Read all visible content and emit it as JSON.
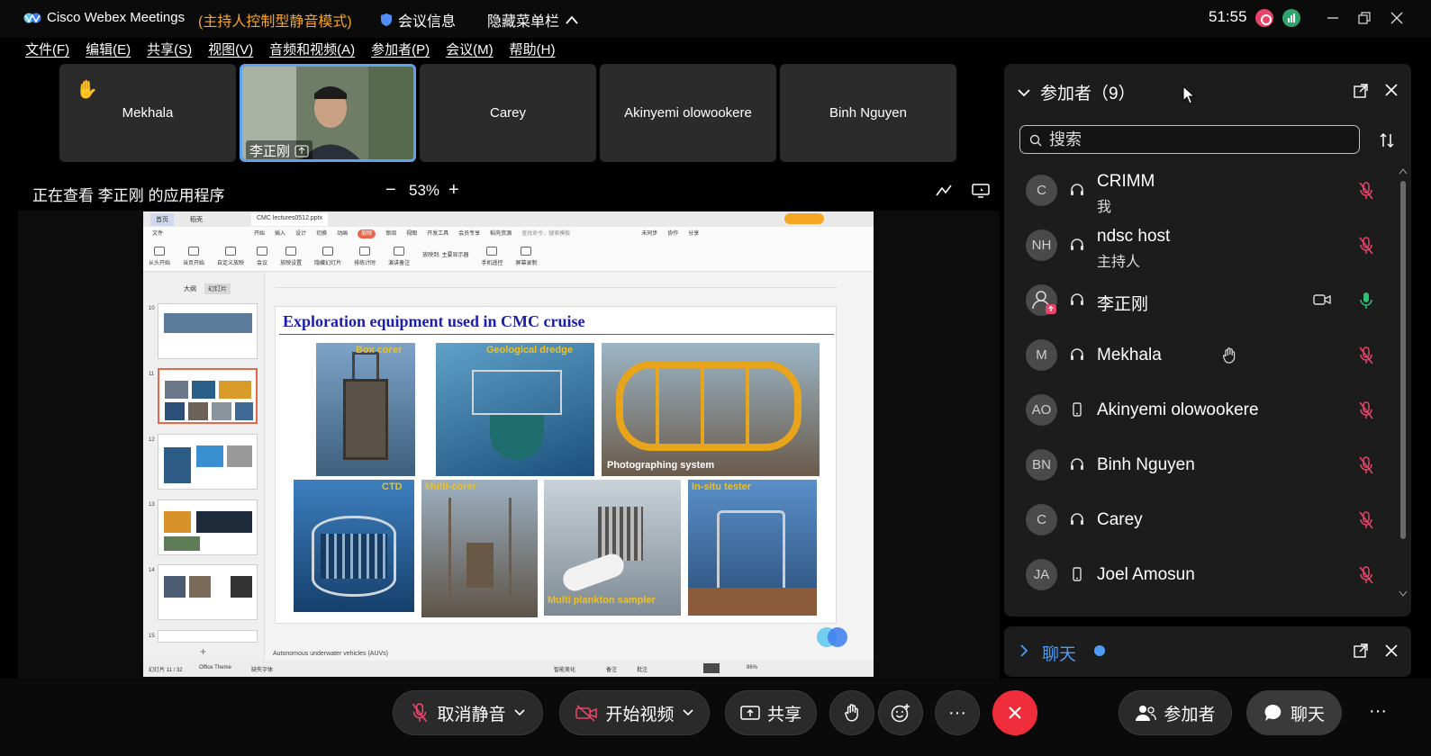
{
  "titlebar": {
    "app_name": "Cisco Webex Meetings",
    "mode": "(主持人控制型静音模式)",
    "meeting_info": "会议信息",
    "hide_menu": "隐藏菜单栏",
    "clock": "51:55"
  },
  "menu": [
    "文件(F)",
    "编辑(E)",
    "共享(S)",
    "视图(V)",
    "音频和视频(A)",
    "参加者(P)",
    "会议(M)",
    "帮助(H)"
  ],
  "tiles": [
    {
      "name": "Mekhala",
      "hand": "✋"
    },
    {
      "name": "李正刚",
      "active": true
    },
    {
      "name": "Carey"
    },
    {
      "name": "Akinyemi olowookere"
    },
    {
      "name": "Binh Nguyen"
    }
  ],
  "viewing": {
    "label": "正在查看 李正刚 的应用程序",
    "zoom": "53%"
  },
  "ppt": {
    "tabs": [
      "首页",
      "稻壳",
      "CMC lectures0512.pptx"
    ],
    "ribbon_menu": [
      "文件",
      "开始",
      "插入",
      "设计",
      "切换",
      "动画",
      "放映",
      "审阅",
      "视图",
      "开发工具",
      "会员专享",
      "稻壳资源",
      "查找命令、搜索模板",
      "未同步",
      "协作",
      "分享"
    ],
    "ribbon_tools": [
      "从头开始",
      "当页开始",
      "自定义放映",
      "会议",
      "放映设置",
      "隐藏幻灯片",
      "排练计时",
      "演讲备注",
      "放映到: 主要显示器",
      "手机遥控",
      "屏幕录制"
    ],
    "panel_tabs": [
      "大纲",
      "幻灯片"
    ],
    "thumb_numbers": [
      "10",
      "11",
      "12",
      "13",
      "14",
      "15"
    ],
    "slide_title": "Exploration equipment used in CMC cruise",
    "captions": {
      "box": "Box corer",
      "dredge": "Geological dredge",
      "photo": "Photographing system",
      "ctd": "CTD",
      "multi": "Multi-corer",
      "plankton": "Multi plankton sampler",
      "insitu": "In-situ tester"
    },
    "notes": "Autonomous underwater vehicles (AUVs)",
    "status_left": "幻灯片 11 / 32",
    "status_theme": "Office Theme",
    "status_font": "缺失字体",
    "status_beauty": "智能美化",
    "status_notes": "备注",
    "status_comments": "批注",
    "status_zoom": "86%"
  },
  "participants": {
    "header": "参加者（9）",
    "search_placeholder": "搜索",
    "list": [
      {
        "avatar": "C",
        "name": "CRIMM",
        "role": "我",
        "device": "headset"
      },
      {
        "avatar": "NH",
        "name": "ndsc host",
        "role": "主持人",
        "device": "headset"
      },
      {
        "avatar": "",
        "name": "李正刚",
        "role": "",
        "device": "headset"
      },
      {
        "avatar": "M",
        "name": "Mekhala",
        "role": "",
        "device": "headset",
        "hand": true
      },
      {
        "avatar": "AO",
        "name": "Akinyemi olowookere",
        "role": "",
        "device": "phone"
      },
      {
        "avatar": "BN",
        "name": "Binh Nguyen",
        "role": "",
        "device": "headset"
      },
      {
        "avatar": "C",
        "name": "Carey",
        "role": "",
        "device": "headset"
      },
      {
        "avatar": "JA",
        "name": "Joel Amosun",
        "role": "",
        "device": "phone"
      }
    ]
  },
  "chat": {
    "header": "聊天"
  },
  "controls": {
    "unmute": "取消静音",
    "start_video": "开始视频",
    "share": "共享",
    "participants": "参加者",
    "chat": "聊天",
    "more": "···"
  },
  "colors": {
    "accent_orange": "#f5a623",
    "end_red": "#f02d3a",
    "mute_red": "#e8446a",
    "active_tile_border": "#5da2f0",
    "slide_title_blue": "#1d1dad"
  }
}
